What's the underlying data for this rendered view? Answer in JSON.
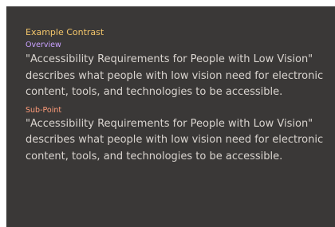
{
  "title": "Example Contrast",
  "sections": [
    {
      "heading": "Overview",
      "text": "\"Accessibility Requirements for People with Low Vision\" describes what people with low vision need for electronic content, tools, and technologies to be accessible."
    },
    {
      "heading": "Sub-Point",
      "text": "\"Accessibility Requirements for People with Low Vision\" describes what people with low vision need for electronic content, tools, and technologies to be accessible."
    }
  ],
  "colors": {
    "page_background": "#ffffff",
    "panel_background": "#3a3837",
    "title": "#f2c56a",
    "overview_heading": "#c9a1ff",
    "subpoint_heading": "#ff9c7a",
    "body_text": "#d9d4cf"
  }
}
